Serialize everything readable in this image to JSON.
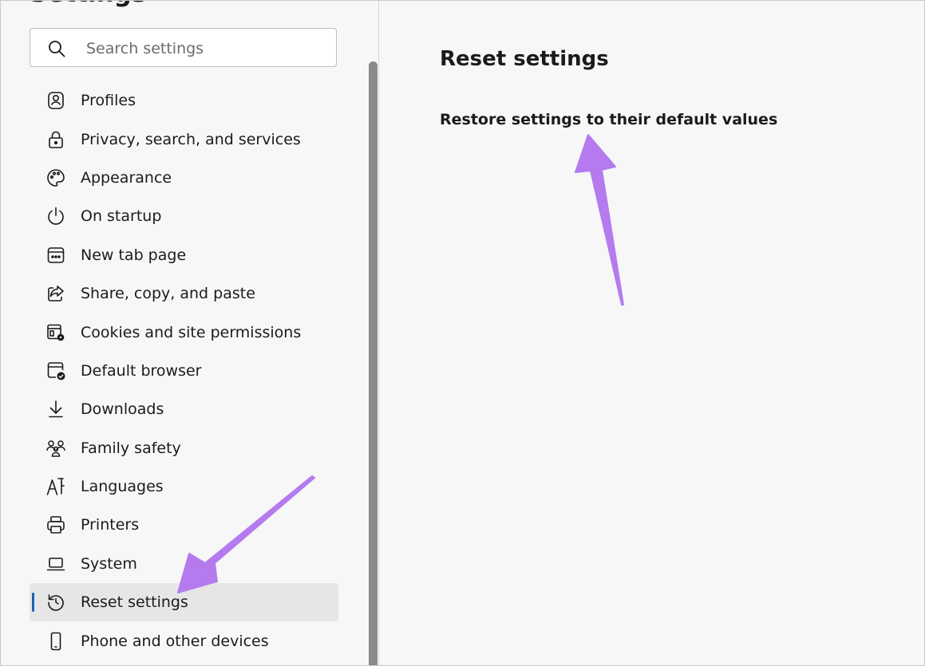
{
  "sidebar": {
    "heading": "Settings",
    "search": {
      "placeholder": "Search settings",
      "value": ""
    },
    "items": [
      {
        "label": "Profiles",
        "icon": "profile-icon"
      },
      {
        "label": "Privacy, search, and services",
        "icon": "lock-icon"
      },
      {
        "label": "Appearance",
        "icon": "palette-icon"
      },
      {
        "label": "On startup",
        "icon": "power-icon"
      },
      {
        "label": "New tab page",
        "icon": "new-tab-icon"
      },
      {
        "label": "Share, copy, and paste",
        "icon": "share-icon"
      },
      {
        "label": "Cookies and site permissions",
        "icon": "cookies-icon"
      },
      {
        "label": "Default browser",
        "icon": "default-browser-icon"
      },
      {
        "label": "Downloads",
        "icon": "download-icon"
      },
      {
        "label": "Family safety",
        "icon": "family-icon"
      },
      {
        "label": "Languages",
        "icon": "languages-icon"
      },
      {
        "label": "Printers",
        "icon": "printer-icon"
      },
      {
        "label": "System",
        "icon": "laptop-icon"
      },
      {
        "label": "Reset settings",
        "icon": "reset-icon",
        "active": true
      },
      {
        "label": "Phone and other devices",
        "icon": "phone-icon"
      }
    ]
  },
  "main": {
    "title": "Reset settings",
    "restore_label": "Restore settings to their default values"
  },
  "colors": {
    "accent": "#1863b5",
    "annotation_arrow": "#b57bee",
    "background": "#f7f7f7",
    "active_item_bg": "#e6e6e6"
  }
}
